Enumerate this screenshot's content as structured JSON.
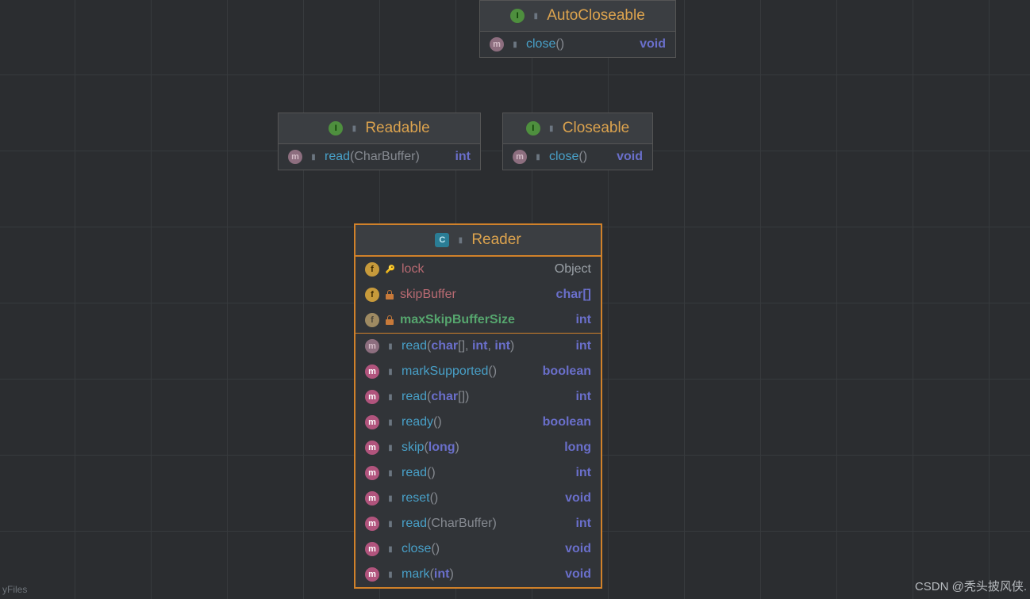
{
  "nodes": {
    "autocloseable": {
      "title": "AutoCloseable",
      "members": [
        {
          "kind": "ma",
          "sig": [
            {
              "c": "mname",
              "t": "close"
            },
            {
              "c": "p",
              "t": "()"
            }
          ],
          "ret": "void",
          "retc": "ret"
        }
      ]
    },
    "readable": {
      "title": "Readable",
      "members": [
        {
          "kind": "ma",
          "sig": [
            {
              "c": "mname",
              "t": "read"
            },
            {
              "c": "p",
              "t": "("
            },
            {
              "c": "t",
              "t": "CharBuffer"
            },
            {
              "c": "p",
              "t": ")"
            }
          ],
          "ret": "int",
          "retc": "ret"
        }
      ]
    },
    "closeable": {
      "title": "Closeable",
      "members": [
        {
          "kind": "ma",
          "sig": [
            {
              "c": "mname",
              "t": "close"
            },
            {
              "c": "p",
              "t": "()"
            }
          ],
          "ret": "void",
          "retc": "ret"
        }
      ]
    },
    "reader": {
      "title": "Reader",
      "fields": [
        {
          "kind": "f",
          "vis": "key",
          "sig": [
            {
              "c": "fname",
              "t": "lock"
            }
          ],
          "ret": "Object",
          "retc": "retg"
        },
        {
          "kind": "f",
          "vis": "pad",
          "sig": [
            {
              "c": "fname",
              "t": "skipBuffer"
            }
          ],
          "ret": "char[]",
          "retc": "ret"
        },
        {
          "kind": "fs",
          "vis": "pad",
          "sig": [
            {
              "c": "gname",
              "t": "maxSkipBufferSize"
            }
          ],
          "ret": "int",
          "retc": "ret"
        }
      ],
      "methods": [
        {
          "kind": "ma",
          "sig": [
            {
              "c": "mname",
              "t": "read"
            },
            {
              "c": "p",
              "t": "("
            },
            {
              "c": "kw",
              "t": "char"
            },
            {
              "c": "p",
              "t": "[], "
            },
            {
              "c": "kw",
              "t": "int"
            },
            {
              "c": "p",
              "t": ", "
            },
            {
              "c": "kw",
              "t": "int"
            },
            {
              "c": "p",
              "t": ")"
            }
          ],
          "ret": "int",
          "retc": "ret"
        },
        {
          "kind": "m",
          "sig": [
            {
              "c": "mname",
              "t": "markSupported"
            },
            {
              "c": "p",
              "t": "()"
            }
          ],
          "ret": "boolean",
          "retc": "ret"
        },
        {
          "kind": "m",
          "sig": [
            {
              "c": "mname",
              "t": "read"
            },
            {
              "c": "p",
              "t": "("
            },
            {
              "c": "kw",
              "t": "char"
            },
            {
              "c": "p",
              "t": "[])"
            }
          ],
          "ret": "int",
          "retc": "ret"
        },
        {
          "kind": "m",
          "sig": [
            {
              "c": "mname",
              "t": "ready"
            },
            {
              "c": "p",
              "t": "()"
            }
          ],
          "ret": "boolean",
          "retc": "ret"
        },
        {
          "kind": "m",
          "sig": [
            {
              "c": "mname",
              "t": "skip"
            },
            {
              "c": "p",
              "t": "("
            },
            {
              "c": "kw",
              "t": "long"
            },
            {
              "c": "p",
              "t": ")"
            }
          ],
          "ret": "long",
          "retc": "ret"
        },
        {
          "kind": "m",
          "sig": [
            {
              "c": "mname",
              "t": "read"
            },
            {
              "c": "p",
              "t": "()"
            }
          ],
          "ret": "int",
          "retc": "ret"
        },
        {
          "kind": "m",
          "sig": [
            {
              "c": "mname",
              "t": "reset"
            },
            {
              "c": "p",
              "t": "()"
            }
          ],
          "ret": "void",
          "retc": "ret"
        },
        {
          "kind": "m",
          "sig": [
            {
              "c": "mname",
              "t": "read"
            },
            {
              "c": "p",
              "t": "("
            },
            {
              "c": "t",
              "t": "CharBuffer"
            },
            {
              "c": "p",
              "t": ")"
            }
          ],
          "ret": "int",
          "retc": "ret"
        },
        {
          "kind": "m",
          "sig": [
            {
              "c": "mname",
              "t": "close"
            },
            {
              "c": "p",
              "t": "()"
            }
          ],
          "ret": "void",
          "retc": "ret"
        },
        {
          "kind": "m",
          "sig": [
            {
              "c": "mname",
              "t": "mark"
            },
            {
              "c": "p",
              "t": "("
            },
            {
              "c": "kw",
              "t": "int"
            },
            {
              "c": "p",
              "t": ")"
            }
          ],
          "ret": "void",
          "retc": "ret"
        }
      ]
    }
  },
  "footer_left": "yFiles",
  "footer_right": "CSDN @秃头披风侠."
}
